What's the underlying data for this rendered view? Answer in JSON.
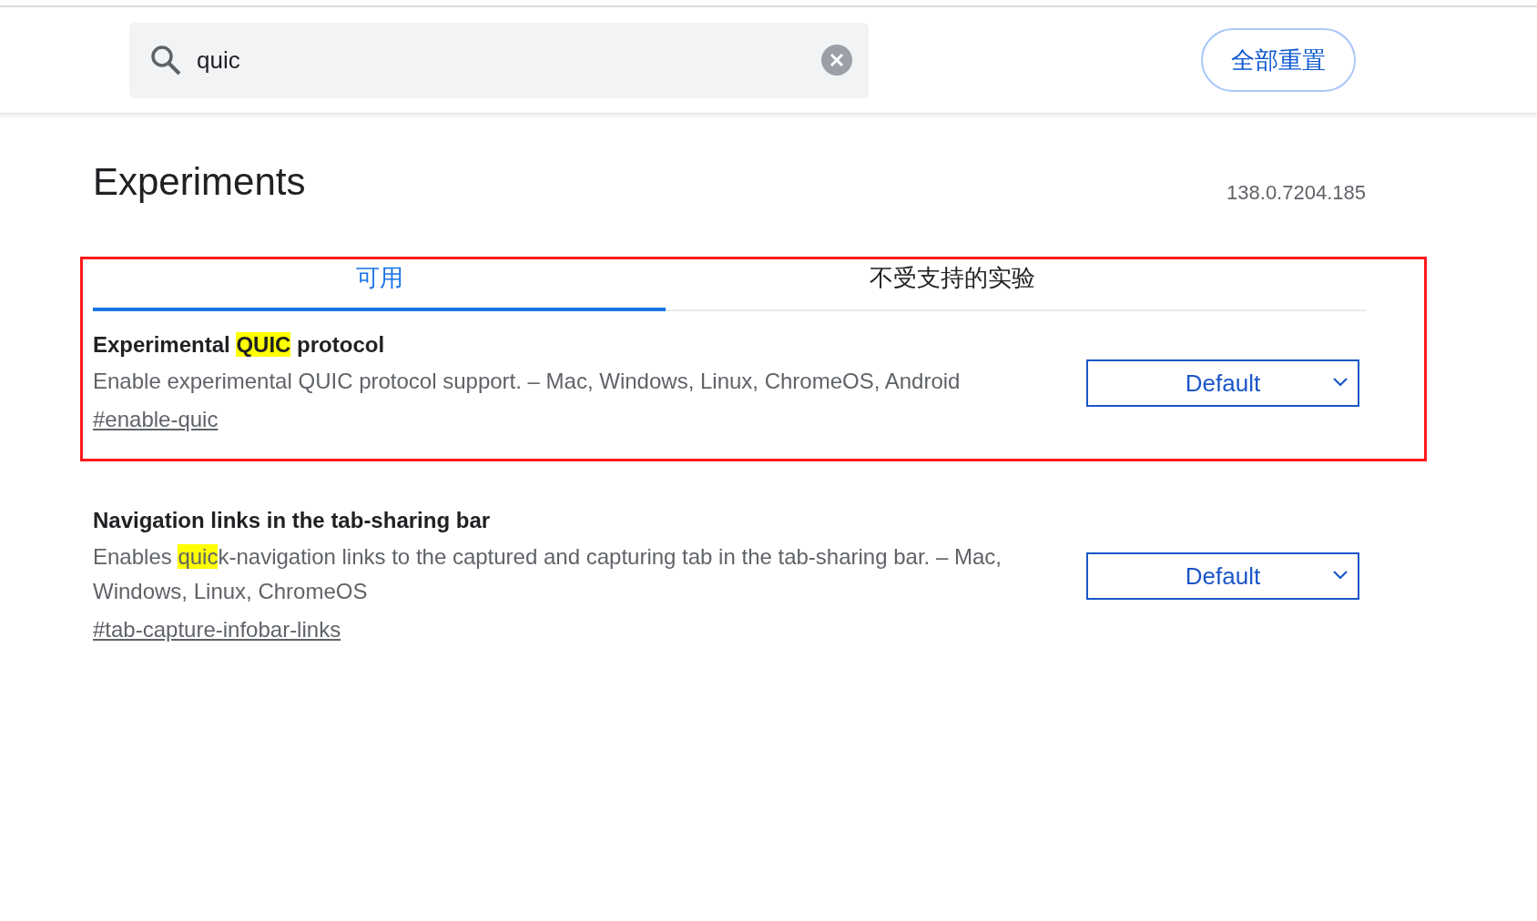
{
  "search": {
    "value": "quic"
  },
  "reset_button": "全部重置",
  "title": "Experiments",
  "version": "138.0.7204.185",
  "tabs": [
    {
      "label": "可用",
      "selected": true
    },
    {
      "label": "不受支持的实验",
      "selected": false
    }
  ],
  "experiments": [
    {
      "title": [
        {
          "text": "Experimental ",
          "highlighted": false
        },
        {
          "text": "QUIC",
          "highlighted": true
        },
        {
          "text": " protocol",
          "highlighted": false
        }
      ],
      "description": [
        {
          "text": "Enable experimental QUIC protocol support. – Mac, Windows, Linux, ChromeOS, Android",
          "highlighted": false
        }
      ],
      "link": "#enable-quic",
      "value": "Default",
      "annotated": true
    },
    {
      "title": [
        {
          "text": "Navigation links in the tab-sharing bar",
          "highlighted": false
        }
      ],
      "description": [
        {
          "text": "Enables ",
          "highlighted": false
        },
        {
          "text": "quic",
          "highlighted": true
        },
        {
          "text": "k-navigation links to the captured and capturing tab in the tab-sharing bar. – Mac, Windows, Linux, ChromeOS",
          "highlighted": false
        }
      ],
      "link": "#tab-capture-infobar-links",
      "value": "Default",
      "annotated": false
    }
  ]
}
